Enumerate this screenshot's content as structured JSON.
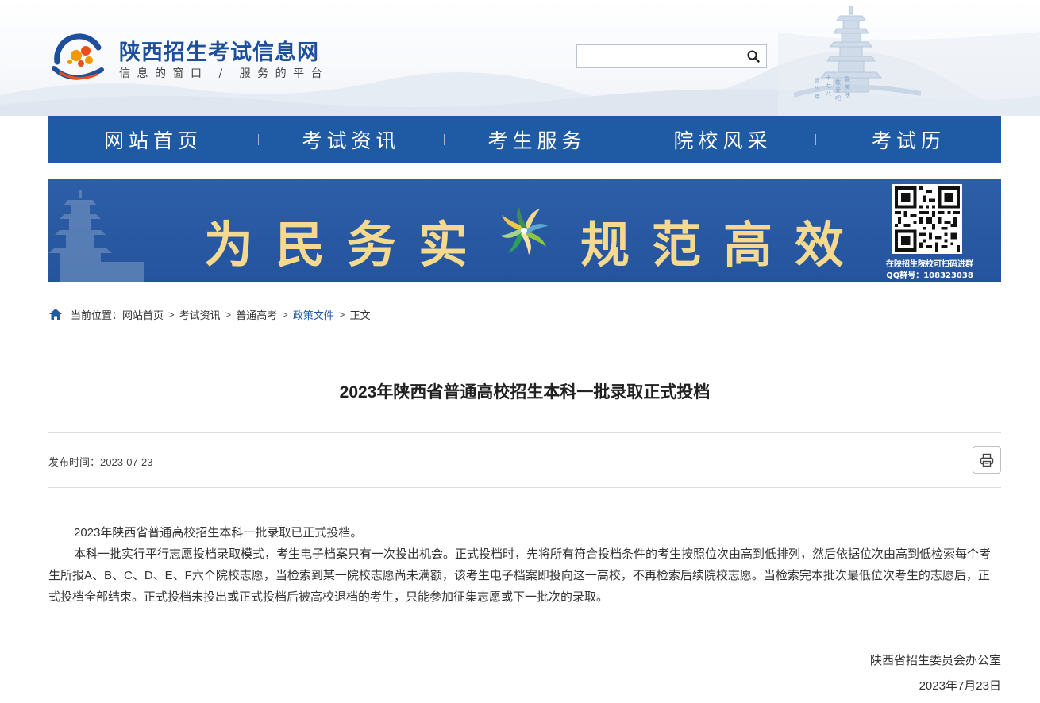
{
  "site": {
    "title": "陕西招生考试信息网",
    "slogan": "信息的窗口 / 服务的平台"
  },
  "search": {
    "placeholder": "",
    "value": "",
    "icon": "search-icon"
  },
  "nav": {
    "items": [
      {
        "label": "网站首页"
      },
      {
        "label": "考试资讯"
      },
      {
        "label": "考生服务"
      },
      {
        "label": "院校风采"
      },
      {
        "label": "考试历"
      }
    ]
  },
  "banner": {
    "slogan_left": "为民务实",
    "slogan_right": "规范高效",
    "qr_caption": "在陕招生院校可扫码进群",
    "qq_group": "QQ群号：108323038"
  },
  "breadcrumb": {
    "prefix": "当前位置：",
    "items": [
      "网站首页",
      "考试资讯",
      "普通高考",
      "政策文件",
      "正文"
    ],
    "separator": ">"
  },
  "article": {
    "title": "2023年陕西省普通高校招生本科一批录取正式投档",
    "publish_label": "发布时间：",
    "publish_date": "2023-07-23",
    "paragraphs": [
      "2023年陕西省普通高校招生本科一批录取已正式投档。",
      "本科一批实行平行志愿投档录取模式，考生电子档案只有一次投出机会。正式投档时，先将所有符合投档条件的考生按照位次由高到低排列，然后依据位次由高到低检索每个考生所报A、B、C、D、E、F六个院校志愿，当检索到某一院校志愿尚未满额，该考生电子档案即投向这一高校，不再检索后续院校志愿。当检索完本批次最低位次考生的志愿后，正式投档全部结束。正式投档未投出或正式投档后被高校退档的考生，只能参加征集志愿或下一批次的录取。"
    ],
    "signature_org": "陕西省招生委员会办公室",
    "signature_date": "2023年7月23日"
  },
  "colors": {
    "brand_blue": "#1f5ba4",
    "banner_gold": "#f4d98f",
    "active_link": "#1f5ba4"
  }
}
